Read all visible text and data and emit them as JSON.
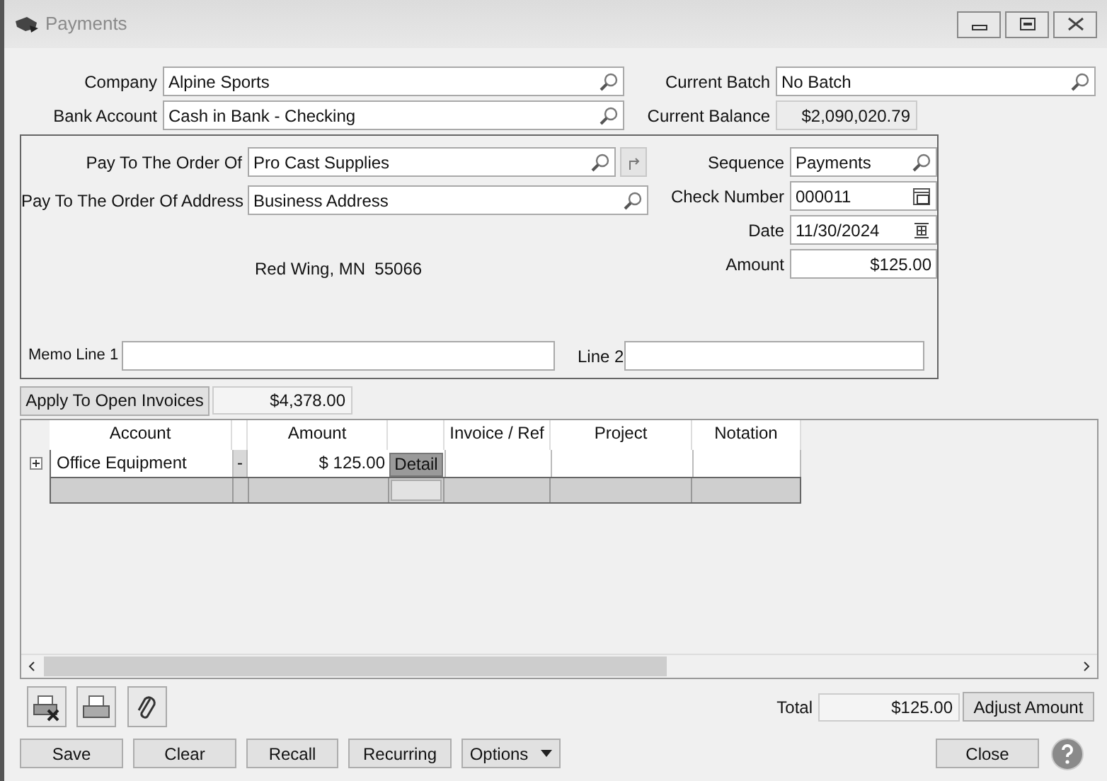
{
  "window": {
    "title": "Payments"
  },
  "company": {
    "label": "Company",
    "value": "Alpine Sports"
  },
  "bank_account": {
    "label": "Bank Account",
    "value": "Cash in Bank - Checking"
  },
  "current_batch": {
    "label": "Current Batch",
    "value": "No Batch"
  },
  "current_balance": {
    "label": "Current Balance",
    "value": "$2,090,020.79"
  },
  "payee": {
    "pay_to": {
      "label": "Pay To The Order Of",
      "value": "Pro Cast Supplies"
    },
    "address": {
      "label": "Pay To The Order Of Address",
      "value": "Business Address"
    },
    "address_text": "Red Wing, MN  55066",
    "sequence": {
      "label": "Sequence",
      "value": "Payments"
    },
    "check_number": {
      "label": "Check Number",
      "value": "000011"
    },
    "date": {
      "label": "Date",
      "value": "11/30/2024"
    },
    "amount": {
      "label": "Amount",
      "value": "$125.00"
    },
    "memo1": {
      "label": "Memo Line 1"
    },
    "memo2": {
      "label": "Line 2"
    }
  },
  "apply": {
    "button": "Apply To Open Invoices",
    "value": "$4,378.00"
  },
  "grid": {
    "columns": [
      {
        "kind": "text",
        "label": "Account"
      },
      {
        "kind": "spacer"
      },
      {
        "kind": "text",
        "label": "Amount"
      },
      {
        "kind": "button"
      },
      {
        "kind": "text",
        "label": "Invoice / Ref"
      },
      {
        "kind": "text",
        "label": "Project"
      },
      {
        "kind": "text",
        "label": "Notation"
      }
    ],
    "rows": [
      {
        "account": "Office Equipment",
        "sign": "-",
        "amount": "$ 125.00",
        "detail": "Detail",
        "expanded": false
      }
    ]
  },
  "total": {
    "label": "Total",
    "value": "$125.00"
  },
  "adjust_button": "Adjust Amount",
  "buttons": [
    {
      "label": "Save",
      "kind": "plain"
    },
    {
      "label": "Clear",
      "kind": "plain"
    },
    {
      "label": "Recall",
      "kind": "plain"
    },
    {
      "label": "Recurring",
      "kind": "plain"
    },
    {
      "label": "Options",
      "kind": "dropdown"
    }
  ],
  "close_button": "Close"
}
